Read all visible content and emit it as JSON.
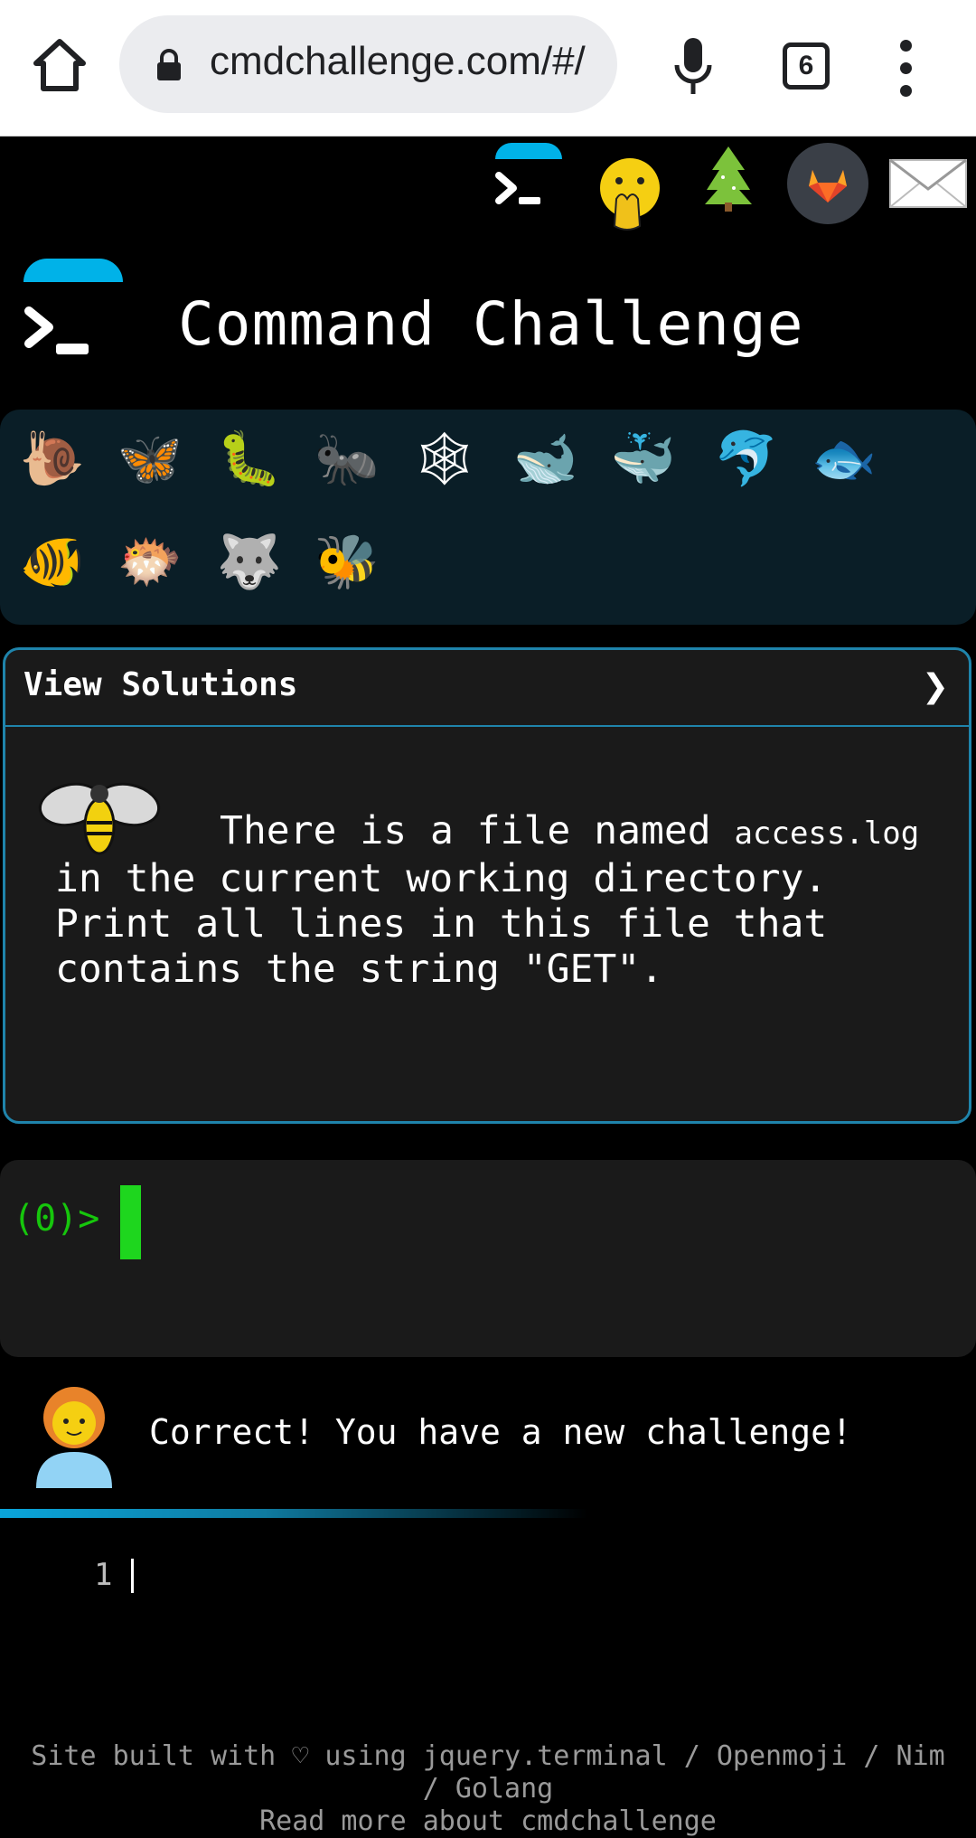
{
  "browser": {
    "url": "cmdchallenge.com/#/",
    "tab_count": "6",
    "home_icon": "home-icon",
    "lock_icon": "lock-icon",
    "mic_icon": "microphone-icon",
    "menu_icon": "more-vert-icon"
  },
  "top_icons": [
    "terminal-logo-icon",
    "face-with-hand-over-mouth-icon",
    "christmas-tree-icon",
    "gitlab-icon",
    "envelope-icon"
  ],
  "header": {
    "title": "Command Challenge"
  },
  "animals": [
    {
      "name": "snail-icon",
      "glyph": "🐌"
    },
    {
      "name": "butterfly-icon",
      "glyph": "🦋"
    },
    {
      "name": "caterpillar-icon",
      "glyph": "🐛"
    },
    {
      "name": "ant-icon",
      "glyph": "🐜"
    },
    {
      "name": "spider-web-icon",
      "glyph": "🕸"
    },
    {
      "name": "whale-icon",
      "glyph": "🐋"
    },
    {
      "name": "spouting-whale-icon",
      "glyph": "🐳"
    },
    {
      "name": "dolphin-icon",
      "glyph": "🐬"
    },
    {
      "name": "fish-icon",
      "glyph": "🐟"
    },
    {
      "name": "tropical-fish-icon",
      "glyph": "🐠"
    },
    {
      "name": "blowfish-icon",
      "glyph": "🐡"
    },
    {
      "name": "wolf-icon",
      "glyph": "🐺"
    },
    {
      "name": "bee-icon",
      "glyph": "🐝"
    }
  ],
  "solutions": {
    "title": "View Solutions",
    "chevron": "❯",
    "desc_before": "There is a file named ",
    "desc_code": "access.log",
    "desc_after": " in the current working directory. Print all lines in this file that contains the string \"GET\"."
  },
  "terminal": {
    "prompt": "(0)>"
  },
  "message": {
    "text": "Correct! You have a new challenge!"
  },
  "editor": {
    "line_number": "1"
  },
  "footer": {
    "line1": "Site built with ♡ using jquery.terminal / Openmoji / Nim / Golang",
    "line2": "Read more about cmdchallenge"
  }
}
